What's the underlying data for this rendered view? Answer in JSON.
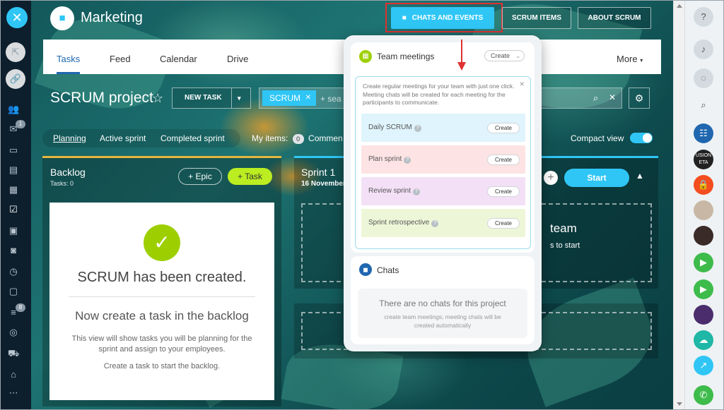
{
  "header": {
    "project_title": "Marketing",
    "buttons": {
      "chats_events": "CHATS AND EVENTS",
      "scrum_items": "SCRUM ITEMS",
      "about_scrum": "ABOUT SCRUM"
    }
  },
  "tabs": [
    {
      "label": "Tasks"
    },
    {
      "label": "Feed"
    },
    {
      "label": "Calendar"
    },
    {
      "label": "Drive"
    },
    {
      "label": "More"
    }
  ],
  "toolbar": {
    "title": "SCRUM project",
    "new_task": "NEW TASK",
    "filter_chip": "SCRUM",
    "filter_placeholder": "+ sea"
  },
  "subfilters": {
    "planning": "Planning",
    "active_sprint": "Active sprint",
    "completed_sprint": "Completed sprint",
    "my_items": "My items:",
    "comments_count": "0",
    "comments": "Commen",
    "compact_view": "Compact view"
  },
  "backlog": {
    "title": "Backlog",
    "tasks": "Tasks: 0",
    "epic_btn": "+ Epic",
    "task_btn": "+ Task",
    "created_title": "SCRUM has been created.",
    "subtitle": "Now create a task in the backlog",
    "description": "This view will show tasks you will be planning for the sprint and assign to your employees.",
    "hint": "Create a task to start the backlog."
  },
  "sprint": {
    "title": "Sprint 1",
    "date": "16 November",
    "start_btn": "Start",
    "drop_title": "team",
    "drop_sub": "s to start"
  },
  "popup": {
    "team_meetings": {
      "title": "Team meetings",
      "create": "Create",
      "description": "Create regular meetings for your team with just one click. Meeting chats will be created for each meeting for the participants to communicate.",
      "items": [
        {
          "label": "Daily SCRUM",
          "button": "Create",
          "color": "#dff4fc"
        },
        {
          "label": "Plan sprint",
          "button": "Create",
          "color": "#fde3e3"
        },
        {
          "label": "Review sprint",
          "button": "Create",
          "color": "#f3e0f6"
        },
        {
          "label": "Sprint retrospective",
          "button": "Create",
          "color": "#eef6d8"
        }
      ]
    },
    "chats": {
      "title": "Chats",
      "empty": "There are no chats for this project",
      "empty_sub": "create team meetings; meeting chats will be created automatically"
    }
  },
  "left_sidebar": {
    "badges": {
      "messages": "1",
      "tasks": "8"
    }
  },
  "right_sidebar": {
    "avatar_text": "USION ETA"
  },
  "colors": {
    "accent": "#2fc6f6",
    "green": "#bbed21",
    "annotation": "#e03131"
  }
}
